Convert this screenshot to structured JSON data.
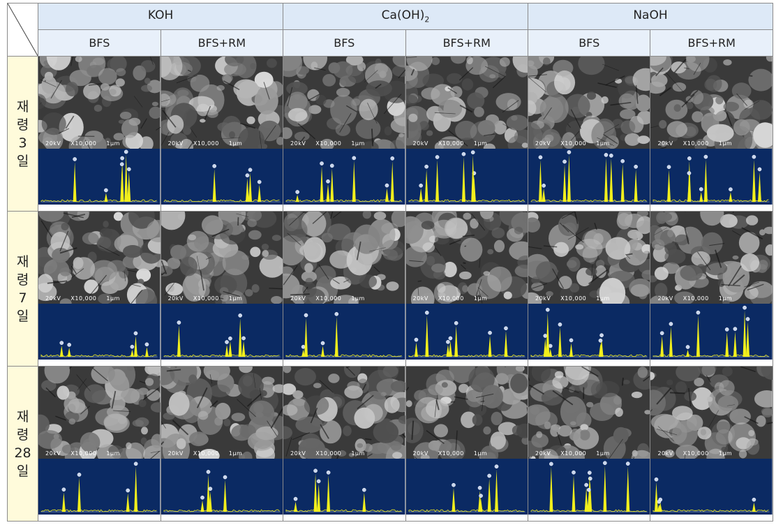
{
  "corner": "",
  "groups": [
    {
      "name": "KOH",
      "name_sub": ""
    },
    {
      "name": "Ca(OH)",
      "name_sub": "2"
    },
    {
      "name": "NaOH",
      "name_sub": ""
    }
  ],
  "subheaders": [
    "BFS",
    "BFS+RM",
    "BFS",
    "BFS+RM",
    "BFS",
    "BFS+RM"
  ],
  "ages": [
    {
      "line1": "재",
      "line2": "령",
      "line3": "3",
      "line4": "일"
    },
    {
      "line1": "재",
      "line2": "령",
      "line3": "7",
      "line4": "일"
    },
    {
      "line1": "재",
      "line2": "령",
      "line3": "28",
      "line4": "일"
    }
  ],
  "sem_label": {
    "kv": "20kV",
    "mag": "X10,000",
    "scale": "1μm"
  },
  "colors": {
    "header_bg": "#dde9f7",
    "age_bg": "#fffbdb",
    "eds_bg": "#0b2a63",
    "eds_peak": "#f2ef1c"
  }
}
